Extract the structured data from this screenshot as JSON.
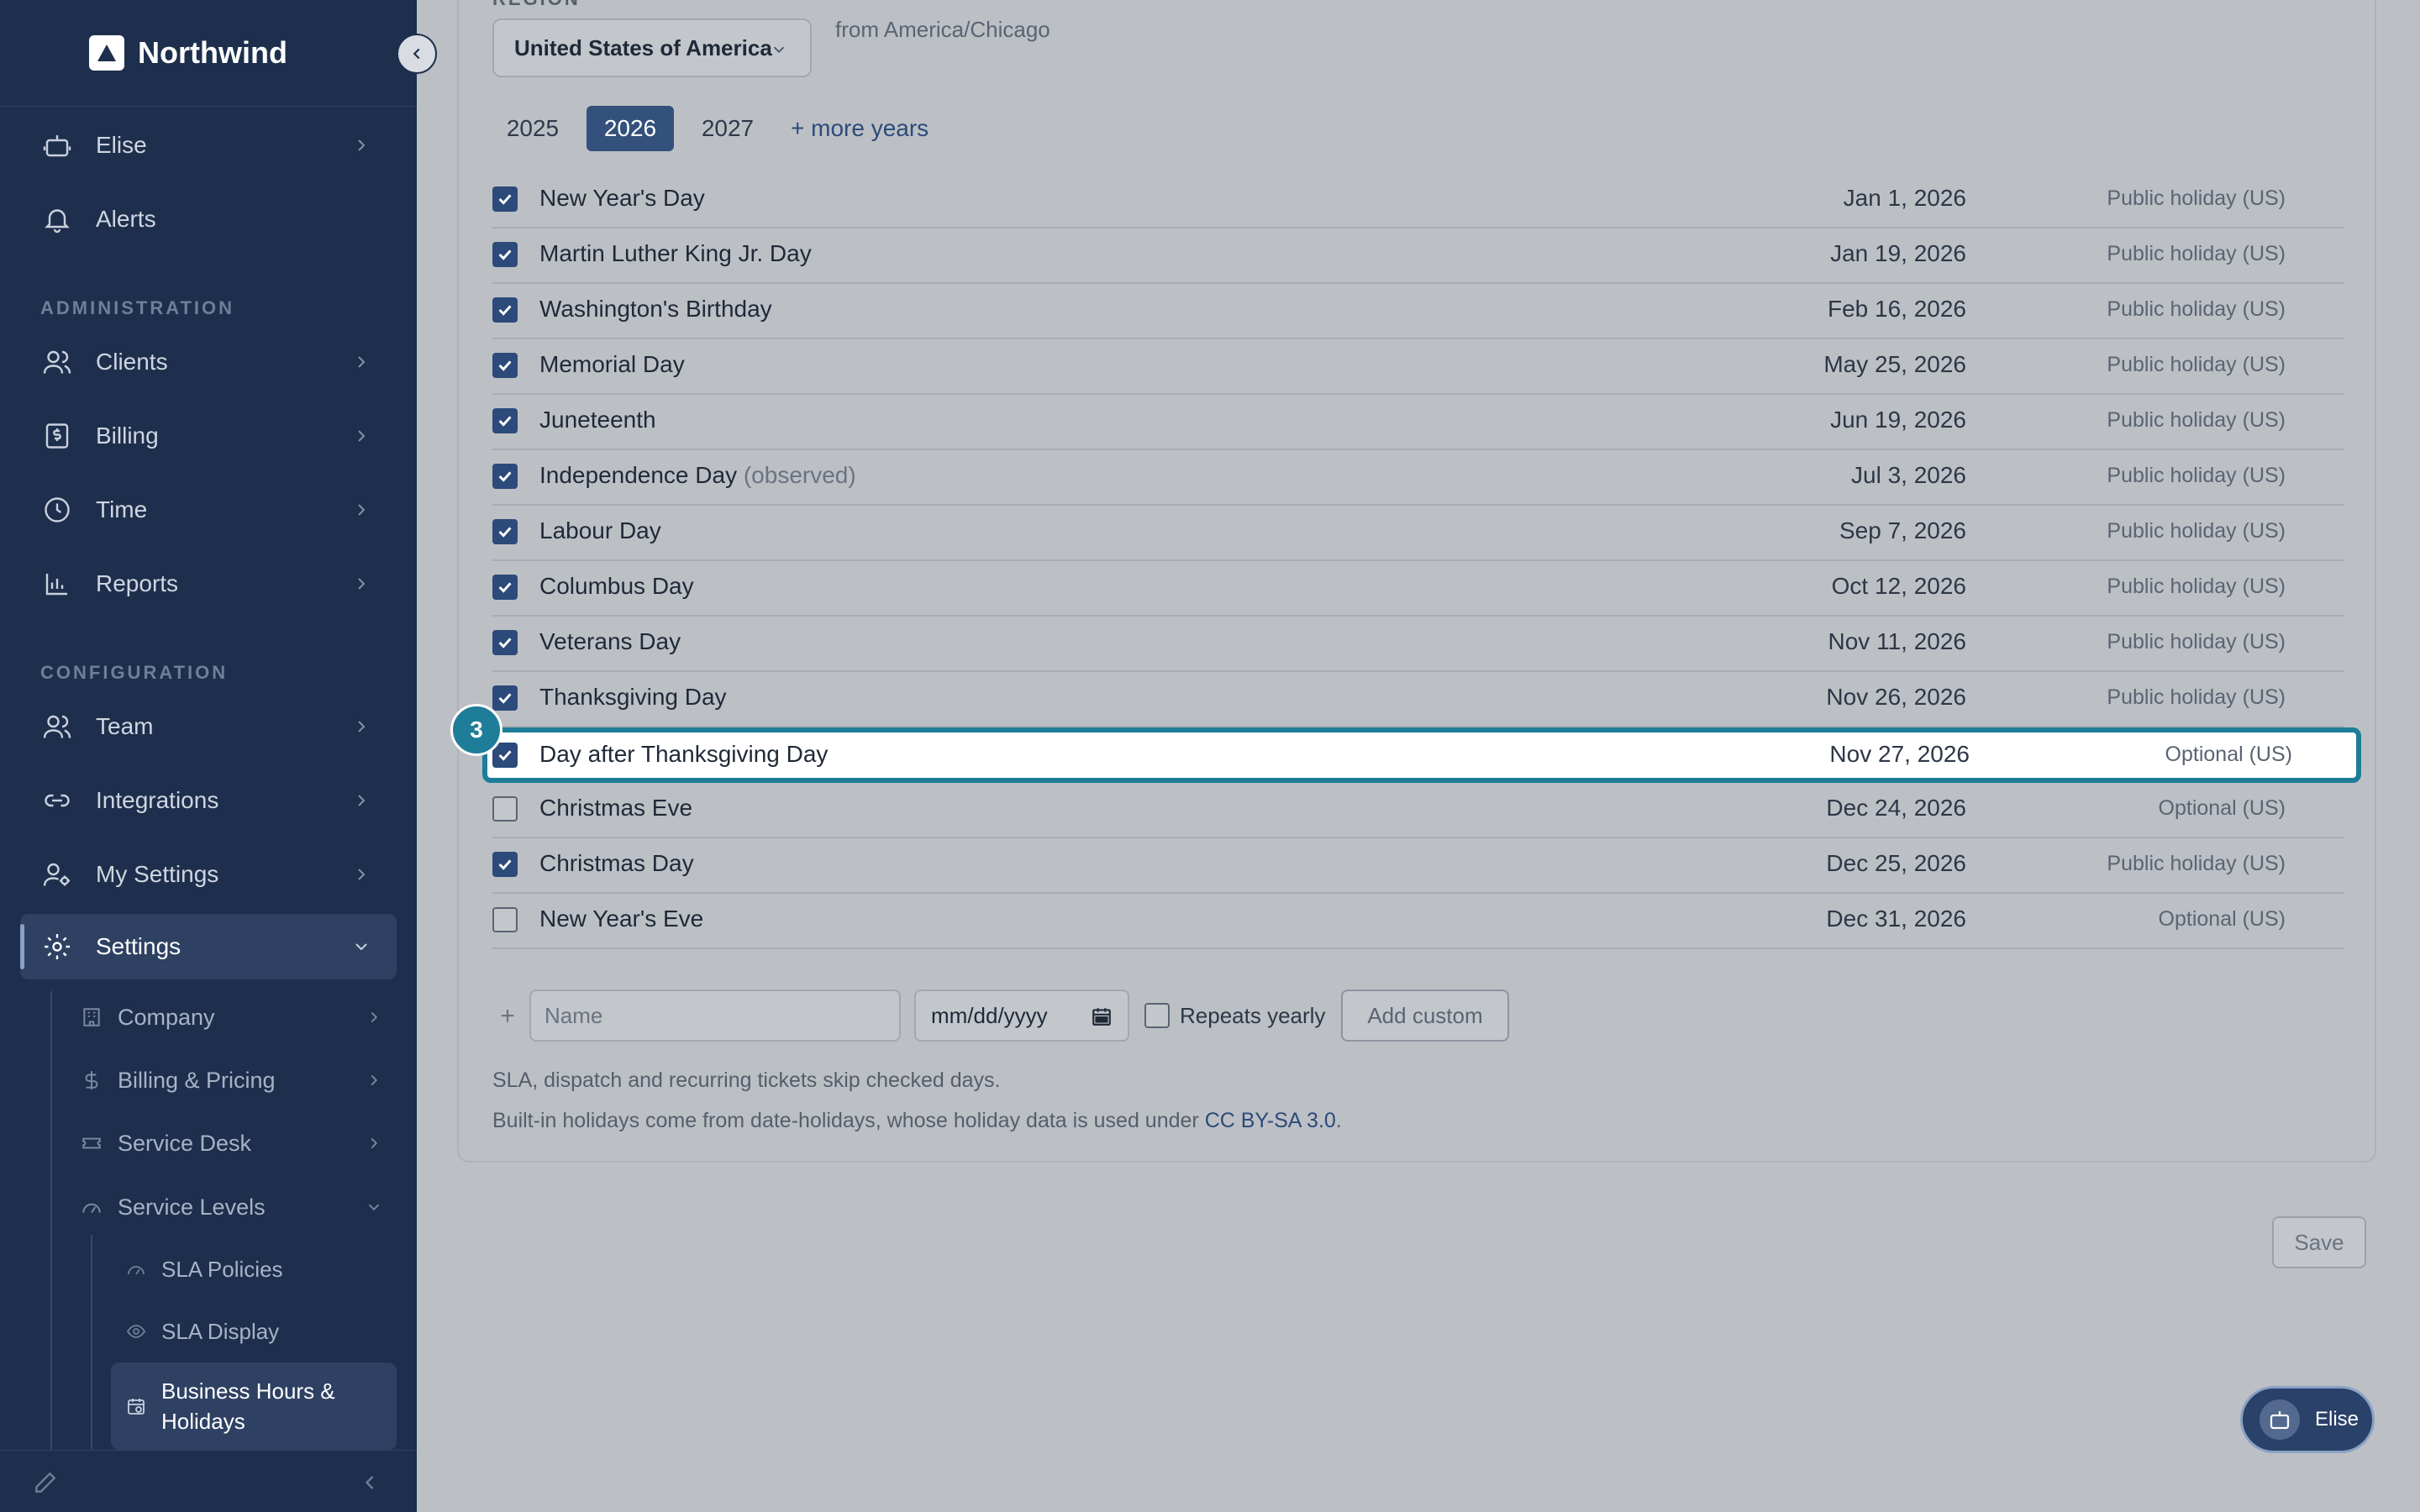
{
  "brand": {
    "name": "Northwind"
  },
  "sidebar": {
    "top_items": [
      {
        "label": "Elise",
        "icon": "robot-icon"
      },
      {
        "label": "Alerts",
        "icon": "bell-icon"
      }
    ],
    "sections": {
      "administration": "ADMINISTRATION",
      "configuration": "CONFIGURATION"
    },
    "admin_items": [
      {
        "label": "Clients"
      },
      {
        "label": "Billing"
      },
      {
        "label": "Time"
      },
      {
        "label": "Reports"
      }
    ],
    "config_items": [
      {
        "label": "Team"
      },
      {
        "label": "Integrations"
      },
      {
        "label": "My Settings"
      },
      {
        "label": "Settings"
      }
    ],
    "settings_sub": [
      {
        "label": "Company"
      },
      {
        "label": "Billing & Pricing"
      },
      {
        "label": "Service Desk"
      },
      {
        "label": "Service Levels"
      }
    ],
    "service_levels_sub": [
      {
        "label": "SLA Policies"
      },
      {
        "label": "SLA Display"
      },
      {
        "label": "Business Hours & Holidays"
      }
    ]
  },
  "region": {
    "label": "REGION",
    "selected": "United States of America",
    "timezone_note": "from America/Chicago"
  },
  "years": {
    "tabs": [
      "2025",
      "2026",
      "2027"
    ],
    "selected": "2026",
    "more": "+ more years"
  },
  "holidays": [
    {
      "name": "New Year's Day",
      "note": "",
      "date": "Jan 1, 2026",
      "type": "Public holiday (US)",
      "checked": true
    },
    {
      "name": "Martin Luther King Jr. Day",
      "note": "",
      "date": "Jan 19, 2026",
      "type": "Public holiday (US)",
      "checked": true
    },
    {
      "name": "Washington's Birthday",
      "note": "",
      "date": "Feb 16, 2026",
      "type": "Public holiday (US)",
      "checked": true
    },
    {
      "name": "Memorial Day",
      "note": "",
      "date": "May 25, 2026",
      "type": "Public holiday (US)",
      "checked": true
    },
    {
      "name": "Juneteenth",
      "note": "",
      "date": "Jun 19, 2026",
      "type": "Public holiday (US)",
      "checked": true
    },
    {
      "name": "Independence Day",
      "note": "(observed)",
      "date": "Jul 3, 2026",
      "type": "Public holiday (US)",
      "checked": true
    },
    {
      "name": "Labour Day",
      "note": "",
      "date": "Sep 7, 2026",
      "type": "Public holiday (US)",
      "checked": true
    },
    {
      "name": "Columbus Day",
      "note": "",
      "date": "Oct 12, 2026",
      "type": "Public holiday (US)",
      "checked": true
    },
    {
      "name": "Veterans Day",
      "note": "",
      "date": "Nov 11, 2026",
      "type": "Public holiday (US)",
      "checked": true
    },
    {
      "name": "Thanksgiving Day",
      "note": "",
      "date": "Nov 26, 2026",
      "type": "Public holiday (US)",
      "checked": true
    },
    {
      "name": "Day after Thanksgiving Day",
      "note": "",
      "date": "Nov 27, 2026",
      "type": "Optional (US)",
      "checked": true,
      "highlight": true,
      "badge": "3"
    },
    {
      "name": "Christmas Eve",
      "note": "",
      "date": "Dec 24, 2026",
      "type": "Optional (US)",
      "checked": false
    },
    {
      "name": "Christmas Day",
      "note": "",
      "date": "Dec 25, 2026",
      "type": "Public holiday (US)",
      "checked": true
    },
    {
      "name": "New Year's Eve",
      "note": "",
      "date": "Dec 31, 2026",
      "type": "Optional (US)",
      "checked": false
    }
  ],
  "custom": {
    "name_placeholder": "Name",
    "date_placeholder": "mm/dd/yyyy",
    "repeats_label": "Repeats yearly",
    "add_label": "Add custom"
  },
  "footnotes": {
    "line1": "SLA, dispatch and recurring tickets skip checked days.",
    "line2_prefix": "Built-in holidays come from date-holidays, whose holiday data is used under ",
    "line2_link": "CC BY-SA 3.0",
    "line2_suffix": "."
  },
  "save_label": "Save",
  "assistant": {
    "label": "Elise"
  },
  "colors": {
    "sidebar_bg": "#1e2f4d",
    "accent": "#2c4a7a",
    "highlight_border": "#1e7d99"
  }
}
